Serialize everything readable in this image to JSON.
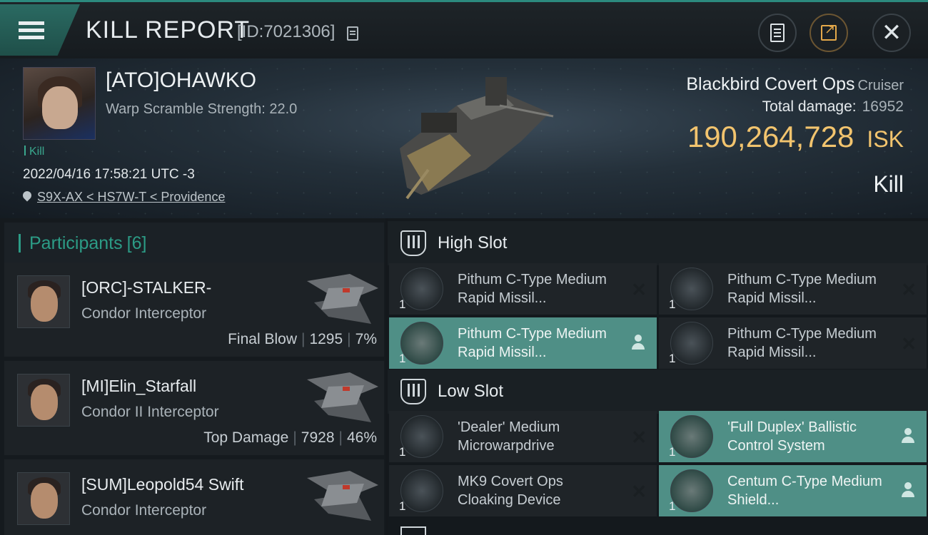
{
  "header": {
    "title": "KILL REPORT",
    "report_id": "[ID:7021306]"
  },
  "victim": {
    "name": "[ATO]OHAWKO",
    "warp_scramble": "Warp Scramble Strength: 22.0",
    "tag": "Kill",
    "datetime": "2022/04/16 17:58:21 UTC -3",
    "location": "S9X-AX < HS7W-T < Providence",
    "ship_name": "Blackbird Covert Ops",
    "ship_class": "Cruiser",
    "total_damage_label": "Total damage:",
    "total_damage": "16952",
    "isk_value": "190,264,728",
    "isk_unit": "ISK",
    "outcome": "Kill"
  },
  "participants": {
    "label": "Participants",
    "count": "[6]",
    "list": [
      {
        "name": "[ORC]-STALKER-",
        "ship": "Condor Interceptor",
        "role": "Final Blow",
        "damage": "1295",
        "percent": "7%"
      },
      {
        "name": "[MI]Elin_Starfall",
        "ship": "Condor II Interceptor",
        "role": "Top Damage",
        "damage": "7928",
        "percent": "46%"
      },
      {
        "name": "[SUM]Leopold54 Swift",
        "ship": "Condor Interceptor"
      }
    ]
  },
  "fitting": {
    "high_slot_label": "High Slot",
    "low_slot_label": "Low Slot",
    "high": [
      {
        "name": "Pithum C-Type Medium Rapid Missil...",
        "qty": "1",
        "state": "destroyed"
      },
      {
        "name": "Pithum C-Type Medium Rapid Missil...",
        "qty": "1",
        "state": "destroyed"
      },
      {
        "name": "Pithum C-Type Medium Rapid Missil...",
        "qty": "1",
        "state": "dropped"
      },
      {
        "name": "Pithum C-Type Medium Rapid Missil...",
        "qty": "1",
        "state": "destroyed"
      }
    ],
    "low": [
      {
        "name": "'Dealer' Medium Microwarpdrive",
        "qty": "1",
        "state": "destroyed"
      },
      {
        "name": "'Full Duplex' Ballistic Control System",
        "qty": "1",
        "state": "dropped"
      },
      {
        "name": "MK9 Covert Ops Cloaking Device",
        "qty": "1",
        "state": "destroyed"
      },
      {
        "name": "Centum C-Type Medium Shield...",
        "qty": "1",
        "state": "dropped"
      }
    ]
  },
  "icons": {
    "destroyed": "x-icon",
    "dropped": "person-icon"
  },
  "colors": {
    "accent": "#2c9c86",
    "isk": "#f2c46e",
    "dropped_bg": "#4f8f86"
  }
}
